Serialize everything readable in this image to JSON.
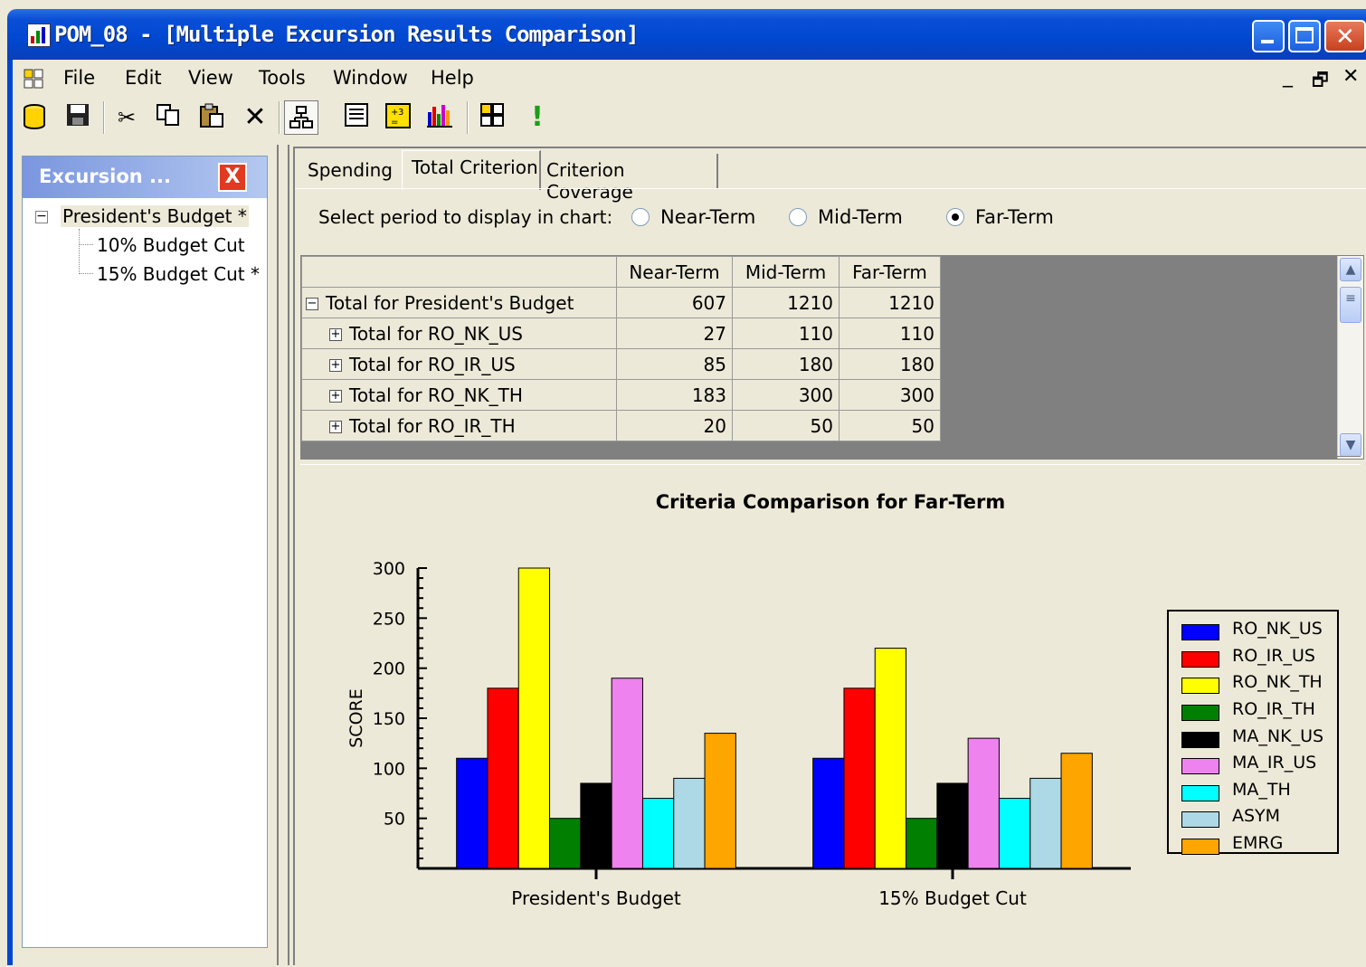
{
  "window": {
    "title": "POM_08 - [Multiple Excursion Results Comparison]",
    "minimize_icon": "minimize-icon",
    "maximize_icon": "maximize-icon",
    "close_icon": "close-icon"
  },
  "menu": {
    "items": [
      "File",
      "Edit",
      "View",
      "Tools",
      "Window",
      "Help"
    ],
    "mdi_minimize": "_",
    "mdi_restore": "🗗",
    "mdi_close": "✕"
  },
  "toolbar": {
    "icons": [
      "database-icon",
      "save-icon",
      "cut-icon",
      "copy-icon",
      "paste-icon",
      "delete-icon",
      "hierarchy-icon",
      "list-icon",
      "calculator-icon",
      "bar-chart-icon",
      "grid-icon",
      "run-icon"
    ]
  },
  "left_panel": {
    "title": "Excursion ...",
    "close_label": "X",
    "tree": [
      {
        "label": "President's Budget *",
        "level": 0,
        "expander": "−"
      },
      {
        "label": "10% Budget Cut",
        "level": 1
      },
      {
        "label": "15% Budget Cut *",
        "level": 1
      }
    ]
  },
  "tabs": [
    {
      "label": "Spending",
      "active": false
    },
    {
      "label": "Total Criterion",
      "active": true
    },
    {
      "label": "Criterion Coverage",
      "active": false
    }
  ],
  "period": {
    "label": "Select period to display in chart:",
    "options": [
      {
        "label": "Near-Term",
        "checked": false
      },
      {
        "label": "Mid-Term",
        "checked": false
      },
      {
        "label": "Far-Term",
        "checked": true
      }
    ]
  },
  "grid": {
    "headers": [
      "",
      "Near-Term",
      "Mid-Term",
      "Far-Term"
    ],
    "rows": [
      {
        "expander": "−",
        "name": "Total for President's Budget",
        "values": [
          "607",
          "1210",
          "1210"
        ]
      },
      {
        "expander": "+",
        "name": "Total for RO_NK_US",
        "values": [
          "27",
          "110",
          "110"
        ]
      },
      {
        "expander": "+",
        "name": "Total for RO_IR_US",
        "values": [
          "85",
          "180",
          "180"
        ]
      },
      {
        "expander": "+",
        "name": "Total for RO_NK_TH",
        "values": [
          "183",
          "300",
          "300"
        ]
      },
      {
        "expander": "+",
        "name": "Total for RO_IR_TH",
        "values": [
          "20",
          "50",
          "50"
        ]
      }
    ]
  },
  "chart_data": {
    "type": "bar",
    "title": "Criteria Comparison for Far-Term",
    "ylabel": "SCORE",
    "xlabel": "",
    "ylim": [
      0,
      300
    ],
    "yticks": [
      50,
      100,
      150,
      200,
      250,
      300
    ],
    "categories": [
      "President's Budget",
      "15% Budget Cut"
    ],
    "legend_position": "right",
    "series": [
      {
        "name": "RO_NK_US",
        "color": "#0000ff",
        "values": [
          110,
          110
        ]
      },
      {
        "name": "RO_IR_US",
        "color": "#ff0000",
        "values": [
          180,
          180
        ]
      },
      {
        "name": "RO_NK_TH",
        "color": "#ffff00",
        "values": [
          300,
          220
        ]
      },
      {
        "name": "RO_IR_TH",
        "color": "#007f00",
        "values": [
          50,
          50
        ]
      },
      {
        "name": "MA_NK_US",
        "color": "#000000",
        "values": [
          85,
          85
        ]
      },
      {
        "name": "MA_IR_US",
        "color": "#ee82ee",
        "values": [
          190,
          130
        ]
      },
      {
        "name": "MA_TH",
        "color": "#00ffff",
        "values": [
          70,
          70
        ]
      },
      {
        "name": "ASYM",
        "color": "#add8e6",
        "values": [
          90,
          90
        ]
      },
      {
        "name": "EMRG",
        "color": "#ffa500",
        "values": [
          135,
          115
        ]
      }
    ]
  }
}
